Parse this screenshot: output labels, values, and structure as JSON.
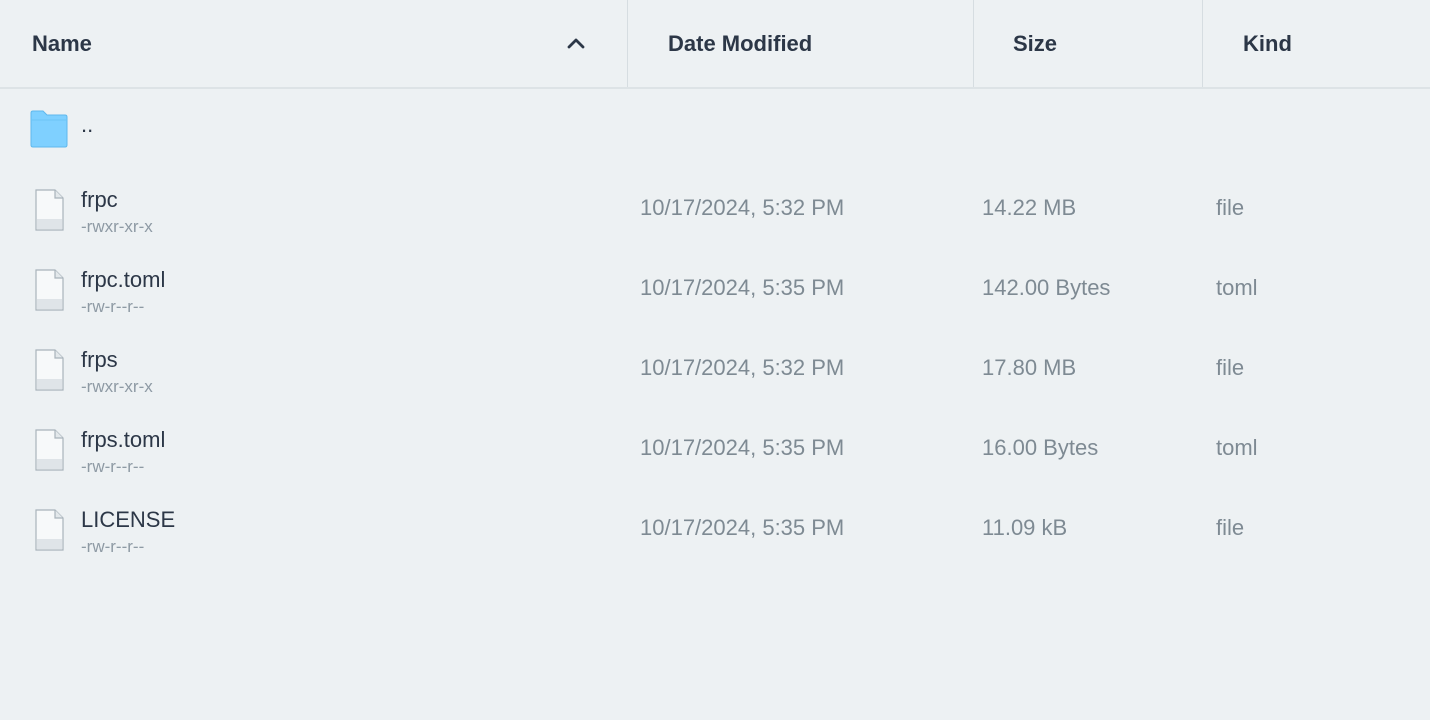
{
  "columns": {
    "name": "Name",
    "date": "Date Modified",
    "size": "Size",
    "kind": "Kind"
  },
  "sort": {
    "column": "name",
    "direction": "ascending",
    "icon": "chevron-up-icon"
  },
  "parent": {
    "name": "..",
    "icon": "folder-icon"
  },
  "files": [
    {
      "name": "frpc",
      "perm": "-rwxr-xr-x",
      "date": "10/17/2024, 5:32 PM",
      "size": "14.22 MB",
      "kind": "file",
      "icon": "file-icon"
    },
    {
      "name": "frpc.toml",
      "perm": "-rw-r--r--",
      "date": "10/17/2024, 5:35 PM",
      "size": "142.00 Bytes",
      "kind": "toml",
      "icon": "file-icon"
    },
    {
      "name": "frps",
      "perm": "-rwxr-xr-x",
      "date": "10/17/2024, 5:32 PM",
      "size": "17.80 MB",
      "kind": "file",
      "icon": "file-icon"
    },
    {
      "name": "frps.toml",
      "perm": "-rw-r--r--",
      "date": "10/17/2024, 5:35 PM",
      "size": "16.00 Bytes",
      "kind": "toml",
      "icon": "file-icon"
    },
    {
      "name": "LICENSE",
      "perm": "-rw-r--r--",
      "date": "10/17/2024, 5:35 PM",
      "size": "11.09 kB",
      "kind": "file",
      "icon": "file-icon"
    }
  ],
  "colors": {
    "background": "#edf1f3",
    "folder": "#7fd0ff",
    "text_primary": "#2c3747",
    "text_secondary": "#7e8a93"
  }
}
